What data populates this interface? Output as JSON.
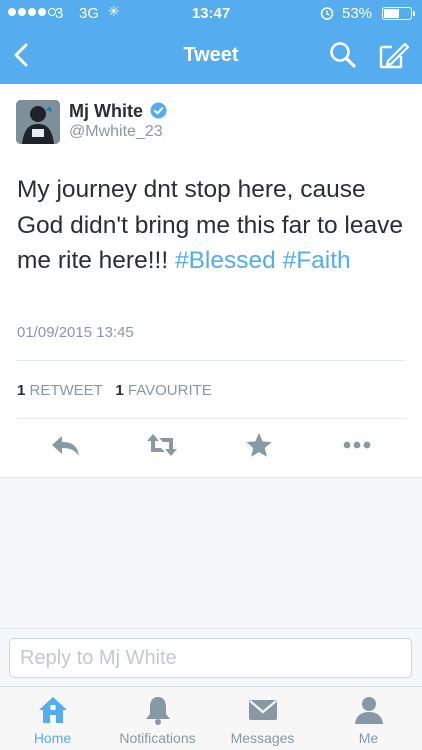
{
  "status_bar": {
    "carrier": "3",
    "network": "3G",
    "time": "13:47",
    "battery_percent": "53%",
    "battery_level": 0.53,
    "icons": [
      "signal-icon",
      "activity-icon",
      "alarm-icon",
      "battery-icon"
    ]
  },
  "nav": {
    "title": "Tweet",
    "icons": [
      "back-icon",
      "search-icon",
      "compose-icon"
    ]
  },
  "tweet": {
    "author_name": "Mj White",
    "author_handle": "@Mwhite_23",
    "verified": true,
    "text_before": "My journey dnt stop here, cause God didn't bring me this far to leave me rite here!!!",
    "hashtags": [
      "#Blessed",
      "#Faith"
    ],
    "timestamp": "01/09/2015 13:45",
    "retweet_count": "1",
    "retweet_label": "RETWEET",
    "favourite_count": "1",
    "favourite_label": "FAVOURITE",
    "actions": [
      "reply-icon",
      "retweet-icon",
      "favourite-icon",
      "more-icon"
    ]
  },
  "reply": {
    "placeholder": "Reply to Mj White"
  },
  "tabs": [
    {
      "label": "Home",
      "icon": "home-icon",
      "active": true
    },
    {
      "label": "Notifications",
      "icon": "notifications-icon",
      "active": false
    },
    {
      "label": "Messages",
      "icon": "messages-icon",
      "active": false
    },
    {
      "label": "Me",
      "icon": "me-icon",
      "active": false
    }
  ],
  "colors": {
    "brand": "#55acee",
    "text": "#292f33",
    "muted": "#8899a6",
    "background": "#f5f8fa"
  }
}
